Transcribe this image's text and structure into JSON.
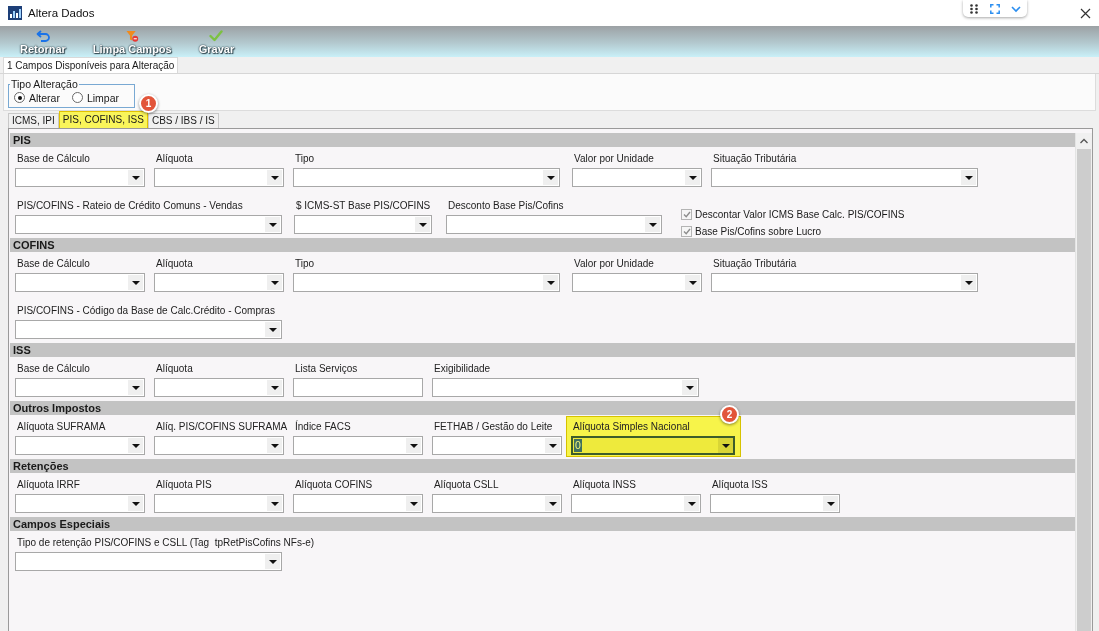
{
  "window": {
    "title": "Altera Dados"
  },
  "toolbar": [
    {
      "label": "Retornar"
    },
    {
      "label": "Limpa Campos"
    },
    {
      "label": "Gravar"
    }
  ],
  "page_tabs": [
    {
      "label": "1 Campos Disponíveis para Alteração",
      "selected": true
    }
  ],
  "tipo_alteracao": {
    "legend": "Tipo Alteração",
    "options": [
      {
        "label": "Alterar",
        "selected": true
      },
      {
        "label": "Limpar",
        "selected": false
      }
    ]
  },
  "tabs": [
    {
      "label": "ICMS, IPI",
      "selected": false,
      "highlighted": false
    },
    {
      "label": "PIS, COFINS, ISS",
      "selected": true,
      "highlighted": true,
      "callout": "1"
    },
    {
      "label": "CBS / IBS / IS",
      "selected": false,
      "highlighted": false
    }
  ],
  "sections": [
    {
      "title": "PIS",
      "fields": [
        {
          "label": "Base de Cálculo",
          "kind": "combo",
          "highlighted": false,
          "focused": false
        },
        {
          "label": "Alíquota",
          "kind": "combo",
          "highlighted": false,
          "focused": false
        },
        {
          "label": "Tipo",
          "kind": "combo",
          "highlighted": false,
          "focused": false
        },
        {
          "label": "Valor por Unidade",
          "kind": "combo",
          "highlighted": false,
          "focused": false
        },
        {
          "label": "Situação Tributária",
          "kind": "combo",
          "highlighted": false,
          "focused": false
        },
        {
          "label": "PIS/COFINS - Rateio de Crédito Comuns - Vendas",
          "kind": "combo",
          "highlighted": false,
          "focused": false
        },
        {
          "label": "$ ICMS-ST Base PIS/COFINS",
          "kind": "combo",
          "highlighted": false,
          "focused": false
        },
        {
          "label": "Desconto Base Pis/Cofins",
          "kind": "combo",
          "highlighted": false,
          "focused": false
        },
        {
          "kind": "checkboxes",
          "items": [
            {
              "label": "Descontar Valor ICMS Base Calc. PIS/COFINS",
              "checked": true
            },
            {
              "label": "Base Pis/Cofins sobre Lucro",
              "checked": true
            }
          ]
        }
      ]
    },
    {
      "title": "COFINS",
      "fields": [
        {
          "label": "Base de Cálculo",
          "kind": "combo",
          "highlighted": false,
          "focused": false
        },
        {
          "label": "Alíquota",
          "kind": "combo",
          "highlighted": false,
          "focused": false
        },
        {
          "label": "Tipo",
          "kind": "combo",
          "highlighted": false,
          "focused": false
        },
        {
          "label": "Valor por Unidade",
          "kind": "combo",
          "highlighted": false,
          "focused": false
        },
        {
          "label": "Situação Tributária",
          "kind": "combo",
          "highlighted": false,
          "focused": false
        },
        {
          "label": "PIS/COFINS - Código da Base de Calc.Crédito - Compras",
          "kind": "combo",
          "highlighted": false,
          "focused": false
        }
      ]
    },
    {
      "title": "ISS",
      "fields": [
        {
          "label": "Base de Cálculo",
          "kind": "combo",
          "highlighted": false,
          "focused": false
        },
        {
          "label": "Alíquota",
          "kind": "combo",
          "highlighted": false,
          "focused": false
        },
        {
          "label": "Lista Serviços",
          "kind": "text",
          "highlighted": false,
          "focused": false
        },
        {
          "label": "Exigibilidade",
          "kind": "combo",
          "highlighted": false,
          "focused": false
        }
      ]
    },
    {
      "title": "Outros Impostos",
      "fields": [
        {
          "label": "Alíquota SUFRAMA",
          "kind": "combo",
          "highlighted": false,
          "focused": false
        },
        {
          "label": "Alíq. PIS/COFINS SUFRAMA",
          "kind": "combo",
          "highlighted": false,
          "focused": false
        },
        {
          "label": "Índice FACS",
          "kind": "combo",
          "highlighted": false,
          "focused": false
        },
        {
          "label": "FETHAB / Gestão do Leite",
          "kind": "combo",
          "highlighted": false,
          "focused": false
        },
        {
          "label": "Alíquota Simples Nacional",
          "kind": "combo",
          "value": "0",
          "highlighted": true,
          "focused": true,
          "callout": "2"
        }
      ]
    },
    {
      "title": "Retenções",
      "fields": [
        {
          "label": "Alíquota IRRF",
          "kind": "combo",
          "highlighted": false,
          "focused": false
        },
        {
          "label": "Alíquota PIS",
          "kind": "combo",
          "highlighted": false,
          "focused": false
        },
        {
          "label": "Alíquota COFINS",
          "kind": "combo",
          "highlighted": false,
          "focused": false
        },
        {
          "label": "Alíquota CSLL",
          "kind": "combo",
          "highlighted": false,
          "focused": false
        },
        {
          "label": "Alíquota INSS",
          "kind": "combo",
          "highlighted": false,
          "focused": false
        },
        {
          "label": "Alíquota ISS",
          "kind": "combo",
          "highlighted": false,
          "focused": false
        }
      ]
    },
    {
      "title": "Campos Especiais",
      "fields": [
        {
          "label": "Tipo de retenção PIS/COFINS e CSLL (Tag  tpRetPisCofins NFs-e)",
          "kind": "combo",
          "highlighted": false,
          "focused": false
        }
      ]
    }
  ]
}
